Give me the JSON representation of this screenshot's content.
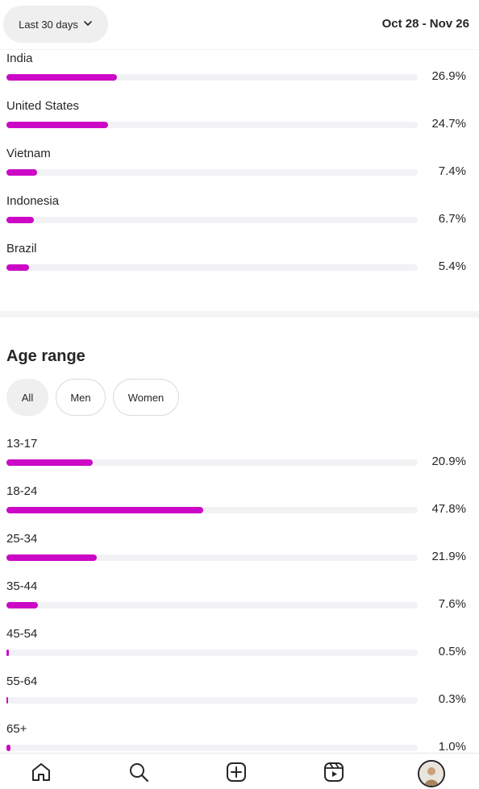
{
  "header": {
    "range_label": "Last 30 days",
    "date_range": "Oct 28 - Nov 26"
  },
  "countries": [
    {
      "label": "India",
      "percent_text": "26.9%",
      "value": 26.9
    },
    {
      "label": "United States",
      "percent_text": "24.7%",
      "value": 24.7
    },
    {
      "label": "Vietnam",
      "percent_text": "7.4%",
      "value": 7.4
    },
    {
      "label": "Indonesia",
      "percent_text": "6.7%",
      "value": 6.7
    },
    {
      "label": "Brazil",
      "percent_text": "5.4%",
      "value": 5.4
    }
  ],
  "age": {
    "title": "Age range",
    "filters": [
      "All",
      "Men",
      "Women"
    ],
    "active_filter": "All",
    "rows": [
      {
        "label": "13-17",
        "percent_text": "20.9%",
        "value": 20.9
      },
      {
        "label": "18-24",
        "percent_text": "47.8%",
        "value": 47.8
      },
      {
        "label": "25-34",
        "percent_text": "21.9%",
        "value": 21.9
      },
      {
        "label": "35-44",
        "percent_text": "7.6%",
        "value": 7.6
      },
      {
        "label": "45-54",
        "percent_text": "0.5%",
        "value": 0.5
      },
      {
        "label": "55-64",
        "percent_text": "0.3%",
        "value": 0.3
      },
      {
        "label": "65+",
        "percent_text": "1.0%",
        "value": 1.0
      }
    ]
  },
  "colors": {
    "accent": "#cc08c6",
    "track": "#f2f2f5",
    "text": "#262626"
  },
  "nav": [
    "home-icon",
    "search-icon",
    "create-icon",
    "reels-icon",
    "profile-avatar"
  ]
}
